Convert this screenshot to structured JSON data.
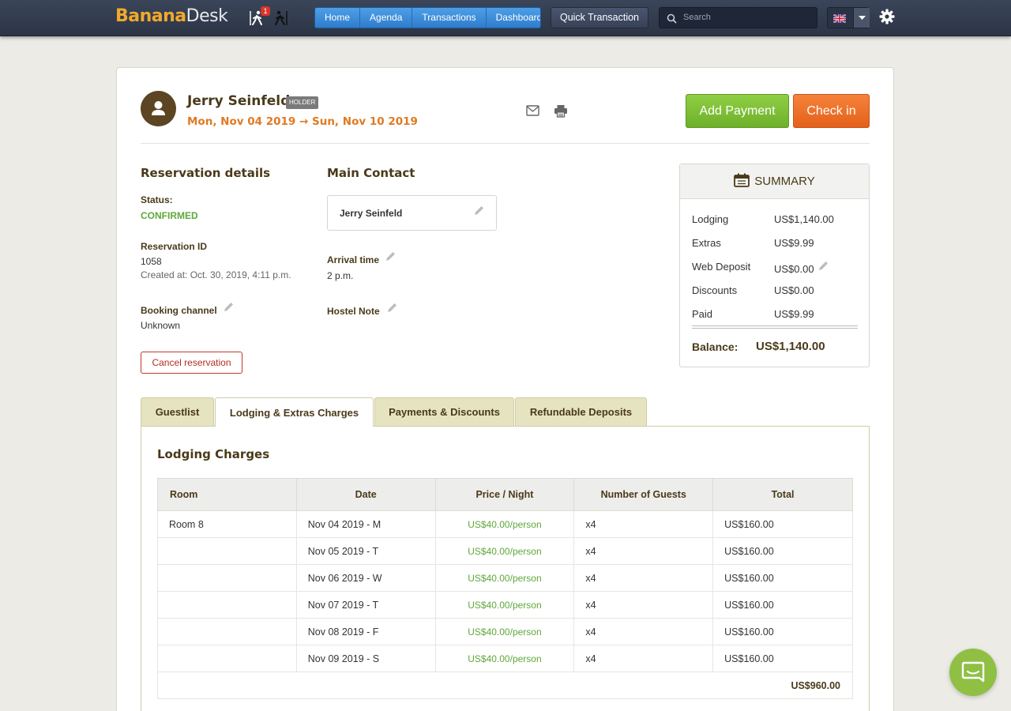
{
  "app": {
    "logo_part1": "Banana",
    "logo_part2": "Desk",
    "notification_count": "1"
  },
  "nav": {
    "items": [
      "Home",
      "Agenda",
      "Transactions",
      "Dashboard"
    ],
    "quick_label": "Quick Transaction",
    "search_placeholder": "Search"
  },
  "guest": {
    "name": "Jerry Seinfeld",
    "role_badge": "HOLDER",
    "dates": "Mon, Nov 04 2019 → Sun, Nov 10 2019"
  },
  "actions": {
    "add_payment": "Add Payment",
    "check_in": "Check in",
    "cancel": "Cancel reservation"
  },
  "details": {
    "title": "Reservation details",
    "status_label": "Status:",
    "status_value": "CONFIRMED",
    "id_label": "Reservation ID",
    "id_value": "1058",
    "created": "Created at: Oct. 30, 2019, 4:11 p.m.",
    "channel_label": "Booking channel",
    "channel_value": "Unknown"
  },
  "contact": {
    "title": "Main Contact",
    "name": "Jerry Seinfeld",
    "arrival_label": "Arrival time",
    "arrival_value": "2 p.m.",
    "note_label": "Hostel Note"
  },
  "summary": {
    "title": "SUMMARY",
    "rows": [
      {
        "label": "Lodging",
        "value": "US$1,140.00"
      },
      {
        "label": "Extras",
        "value": "US$9.99"
      },
      {
        "label": "Web Deposit",
        "value": "US$0.00"
      },
      {
        "label": "Discounts",
        "value": "US$0.00"
      },
      {
        "label": "Paid",
        "value": "US$9.99"
      }
    ],
    "balance_label": "Balance:",
    "balance_value": "US$1,140.00"
  },
  "tabs": [
    "Guestlist",
    "Lodging & Extras Charges",
    "Payments & Discounts",
    "Refundable Deposits"
  ],
  "lodging": {
    "title": "Lodging Charges",
    "columns": [
      "Room",
      "Date",
      "Price / Night",
      "Number of Guests",
      "Total"
    ],
    "rows": [
      {
        "room": "Room 8",
        "date": "Nov 04 2019 - M",
        "price": "US$40.00/person",
        "guests": "x4",
        "total": "US$160.00"
      },
      {
        "room": "",
        "date": "Nov 05 2019 - T",
        "price": "US$40.00/person",
        "guests": "x4",
        "total": "US$160.00"
      },
      {
        "room": "",
        "date": "Nov 06 2019 - W",
        "price": "US$40.00/person",
        "guests": "x4",
        "total": "US$160.00"
      },
      {
        "room": "",
        "date": "Nov 07 2019 - T",
        "price": "US$40.00/person",
        "guests": "x4",
        "total": "US$160.00"
      },
      {
        "room": "",
        "date": "Nov 08 2019 - F",
        "price": "US$40.00/person",
        "guests": "x4",
        "total": "US$160.00"
      },
      {
        "room": "",
        "date": "Nov 09 2019 - S",
        "price": "US$40.00/person",
        "guests": "x4",
        "total": "US$160.00"
      }
    ],
    "subtotal": "US$960.00"
  }
}
